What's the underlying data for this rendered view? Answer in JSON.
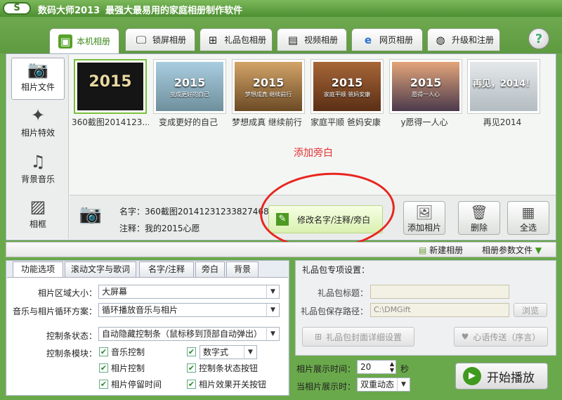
{
  "app": {
    "logo": "S",
    "title": "数码大师2013",
    "subtitle": "最强大最易用的家庭相册制作软件"
  },
  "tabs": [
    {
      "label": "本机相册",
      "icon": "photo-frame-icon"
    },
    {
      "label": "锁屏相册",
      "icon": "monitor-icon"
    },
    {
      "label": "礼品包相册",
      "icon": "gift-icon"
    },
    {
      "label": "视频相册",
      "icon": "film-icon"
    },
    {
      "label": "网页相册",
      "icon": "ie-icon"
    },
    {
      "label": "升级和注册",
      "icon": "globe-icon"
    }
  ],
  "help": "?",
  "sidebar": [
    {
      "label": "相片文件",
      "icon": "camera-icon"
    },
    {
      "label": "相片特效",
      "icon": "sparkle-icon"
    },
    {
      "label": "背景音乐",
      "icon": "music-note-icon"
    },
    {
      "label": "相框",
      "icon": "picture-frame-icon"
    }
  ],
  "thumbnails": [
    {
      "caption": "360截图2014123...",
      "text": "2015",
      "sub": "",
      "color": "#151515"
    },
    {
      "caption": "变成更好的自己",
      "text": "2015",
      "sub": "变成更好的自己",
      "color": "#8bb6cc"
    },
    {
      "caption": "梦想成真 继续前行",
      "text": "2015",
      "sub": "梦想成真 继续前行",
      "color": "#b8864a"
    },
    {
      "caption": "家庭平顺 爸妈安康",
      "text": "2015",
      "sub": "家庭平顺 爸妈安康",
      "color": "#9a5a2e"
    },
    {
      "caption": "y愿得一人心",
      "text": "2015",
      "sub": "愿得一人心",
      "color": "#c08460"
    },
    {
      "caption": "再见2014",
      "text": "再见，2014！",
      "sub": "",
      "color": "#c9d0d4"
    }
  ],
  "annotation": "添加旁白",
  "info": {
    "name": "名字：360截图20141231233827468",
    "note": "注释：我的2015心愿"
  },
  "modify_button": "修改名字/注释/旁白",
  "actions": [
    {
      "label": "添加相片",
      "icon": "add-photo-icon"
    },
    {
      "label": "删除",
      "icon": "trash-icon"
    },
    {
      "label": "全选",
      "icon": "select-all-icon"
    }
  ],
  "toolbar": {
    "new_album": "新建相册",
    "album_param": "相册参数文件"
  },
  "option_tabs": [
    "功能选项",
    "滚动文字与歌词",
    "名字/注释",
    "旁白",
    "背景"
  ],
  "options": {
    "photo_area_label": "相片区域大小：",
    "photo_area_value": "大屏幕",
    "loop_label": "音乐与相片循环方案：",
    "loop_value": "循环播放音乐与相片",
    "control_state_label": "控制条状态：",
    "control_state_value": "自动隐藏控制条（鼠标移到顶部自动弹出）",
    "control_module_label": "控制条模块：",
    "checks": [
      {
        "label": "音乐控制",
        "checked": true
      },
      {
        "label": "数字式",
        "checked": true
      },
      {
        "label": "相片控制",
        "checked": true
      },
      {
        "label": "控制条状态按钮",
        "checked": true
      },
      {
        "label": "相片停留时间",
        "checked": true
      },
      {
        "label": "相片效果开关按钮",
        "checked": true
      }
    ]
  },
  "gift": {
    "title": "礼品包专项设置：",
    "name_label": "礼品包标题：",
    "name_value": "",
    "path_label": "礼品包保存路径：",
    "path_value": "C:\\DMGift",
    "browse": "浏览",
    "cover_button": "礼品包封面详细设置",
    "message_button": "心语传送（序言）"
  },
  "timing": {
    "display_time_label": "相片展示时间：",
    "display_time_value": "20",
    "unit": "秒",
    "display_mode_label": "当相片展示时：",
    "display_mode_value": "双重动态"
  },
  "play_button": "开始播放"
}
